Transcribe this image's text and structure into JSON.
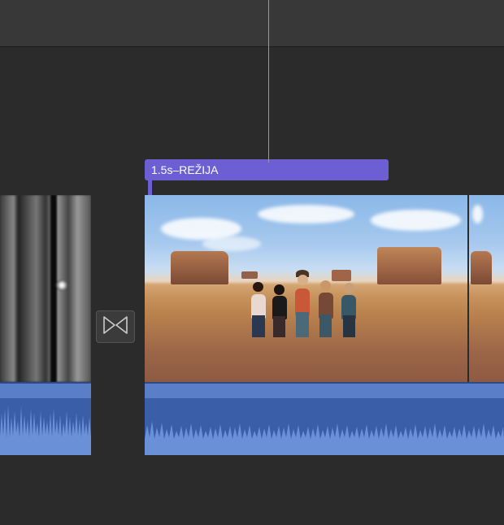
{
  "timeline": {
    "title_clip": {
      "duration_label": "1.5s",
      "separator": " – ",
      "title_text": "REŽIJA"
    },
    "clips": [
      {
        "index": 0,
        "type": "video",
        "content": "motion-blur-street"
      },
      {
        "index": 1,
        "type": "video",
        "content": "monument-valley-group"
      },
      {
        "index": 2,
        "type": "video",
        "content": "monument-valley-group-continued"
      }
    ],
    "transition": {
      "between": [
        0,
        1
      ],
      "icon": "crossfade"
    }
  },
  "colors": {
    "title_bar": "#6d5ed3",
    "audio_track": "#3a5ea8",
    "waveform": "#6a90d8",
    "background": "#2b2b2b"
  }
}
